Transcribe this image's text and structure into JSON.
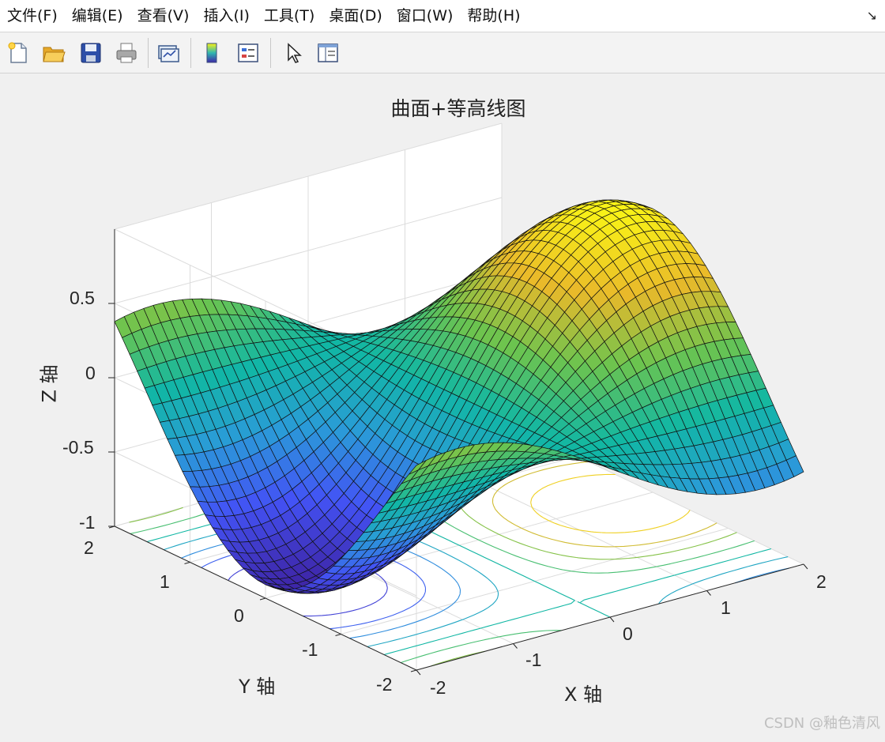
{
  "menu": [
    "文件(F)",
    "编辑(E)",
    "查看(V)",
    "插入(I)",
    "工具(T)",
    "桌面(D)",
    "窗口(W)",
    "帮助(H)"
  ],
  "toolbar_icons": [
    "new-file-icon",
    "open-folder-icon",
    "save-icon",
    "print-icon",
    "link-plot-icon",
    "colorbar-icon",
    "legend-icon",
    "pointer-icon",
    "property-editor-icon"
  ],
  "chart_data": {
    "type": "surface",
    "title": "曲面+等高线图",
    "xlabel": "X 轴",
    "ylabel": "Y 轴",
    "zlabel": "Z 轴",
    "xlim": [
      -2,
      2
    ],
    "ylim": [
      -2,
      2
    ],
    "zlim": [
      -1,
      1
    ],
    "xticks": [
      "-2",
      "-1",
      "0",
      "1",
      "2"
    ],
    "yticks": [
      "-2",
      "-1",
      "0",
      "1",
      "2"
    ],
    "zticks": [
      "-1",
      "-0.5",
      "0",
      "0.5"
    ],
    "function": "z = sin(x)·cos(y)",
    "grid": true,
    "colormap": [
      "#3e26a8",
      "#4353f5",
      "#2a9bd8",
      "#11b7a4",
      "#6cc44f",
      "#e9b92a",
      "#f9f317"
    ],
    "contour_levels": [
      -0.8,
      -0.6,
      -0.4,
      -0.2,
      0,
      0.2,
      0.4,
      0.6,
      0.8
    ],
    "contour_plane_z": -1,
    "view": {
      "azimuth_deg": -37.5,
      "elevation_deg": 30
    }
  },
  "watermark": "CSDN @釉色清风"
}
